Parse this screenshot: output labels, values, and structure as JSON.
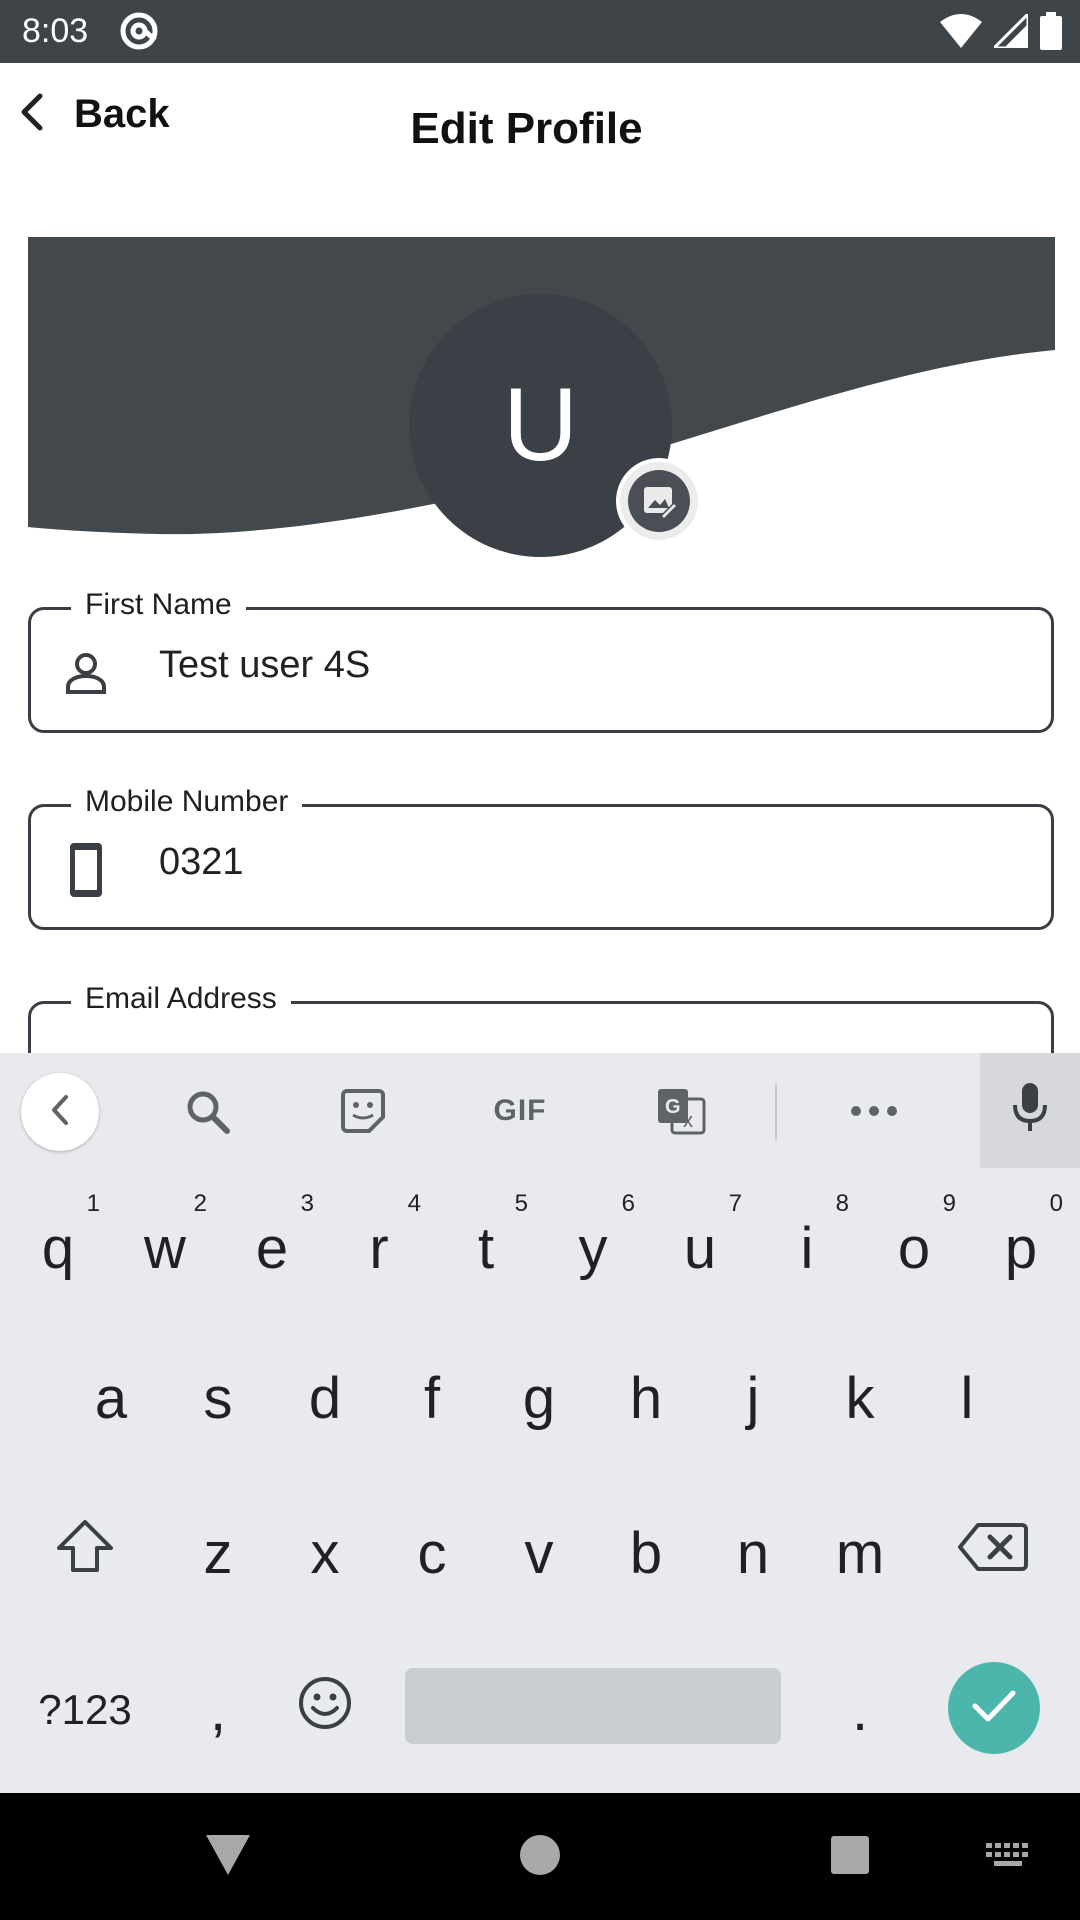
{
  "status_bar": {
    "time": "8:03"
  },
  "header": {
    "back_label": "Back",
    "title": "Edit Profile"
  },
  "profile": {
    "avatar_initial": "U"
  },
  "fields": {
    "first_name": {
      "label": "First Name",
      "value": "Test user 4S"
    },
    "mobile": {
      "label": "Mobile Number",
      "value": "0321"
    },
    "email": {
      "label": "Email Address",
      "value": ""
    }
  },
  "keyboard": {
    "toolbar": {
      "gif_label": "GIF"
    },
    "row1": [
      {
        "char": "q",
        "hint": "1"
      },
      {
        "char": "w",
        "hint": "2"
      },
      {
        "char": "e",
        "hint": "3"
      },
      {
        "char": "r",
        "hint": "4"
      },
      {
        "char": "t",
        "hint": "5"
      },
      {
        "char": "y",
        "hint": "6"
      },
      {
        "char": "u",
        "hint": "7"
      },
      {
        "char": "i",
        "hint": "8"
      },
      {
        "char": "o",
        "hint": "9"
      },
      {
        "char": "p",
        "hint": "0"
      }
    ],
    "row2": [
      "a",
      "s",
      "d",
      "f",
      "g",
      "h",
      "j",
      "k",
      "l"
    ],
    "row3": [
      "z",
      "x",
      "c",
      "v",
      "b",
      "n",
      "m"
    ],
    "symbols_label": "?123",
    "comma": ",",
    "period": "."
  },
  "colors": {
    "accent": "#4db6ac",
    "banner": "#43484c",
    "avatar": "#3b4046",
    "status_bar": "#3f4448"
  }
}
